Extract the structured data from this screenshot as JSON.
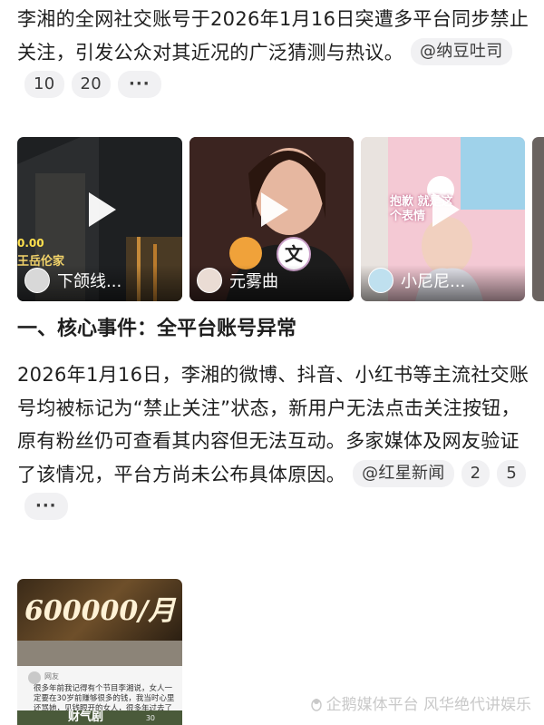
{
  "post1": {
    "text": "李湘的全网社交账号于2026年1月16日突遭多平台同步禁止关注，引发公众对其近况的广泛猜测与热议。",
    "source": "@纳豆吐司",
    "count1": "10",
    "count2": "20",
    "more": "···"
  },
  "videos": [
    {
      "overlay": "王岳伦家",
      "overlay2": "0.00",
      "caption": "下颌线..."
    },
    {
      "overlay": "文",
      "caption": "元雾曲"
    },
    {
      "overlay": "抱歉 就是这个表情",
      "caption": "小尼尼..."
    }
  ],
  "section": {
    "heading": "一、核心事件：全平台账号异常"
  },
  "post2": {
    "text": "2026年1月16日，李湘的微博、抖音、小红书等主流社交账号均被标记为“禁止关注”状态，新用户无法点击关注按钮，原有粉丝仍可查看其内容但无法互动。多家媒体及网友验证了该情况，平台方尚未公布具体原因。",
    "source": "@红星新闻",
    "count1": "2",
    "count2": "5",
    "more": "···"
  },
  "thumb": {
    "banner": "600000/月",
    "user": "网友",
    "text": "很多年前我记得有个节目李湘说，女人一定要在30岁前赚够很多的钱，我当时心里还骂她，见钱眼开的女人，很多年过去了 经历了一些事情以后 我才明白她说的每一句",
    "count": "30",
    "bottom": "财气剧"
  },
  "watermark": "企鹅媒体平台 风华绝代讲娱乐"
}
